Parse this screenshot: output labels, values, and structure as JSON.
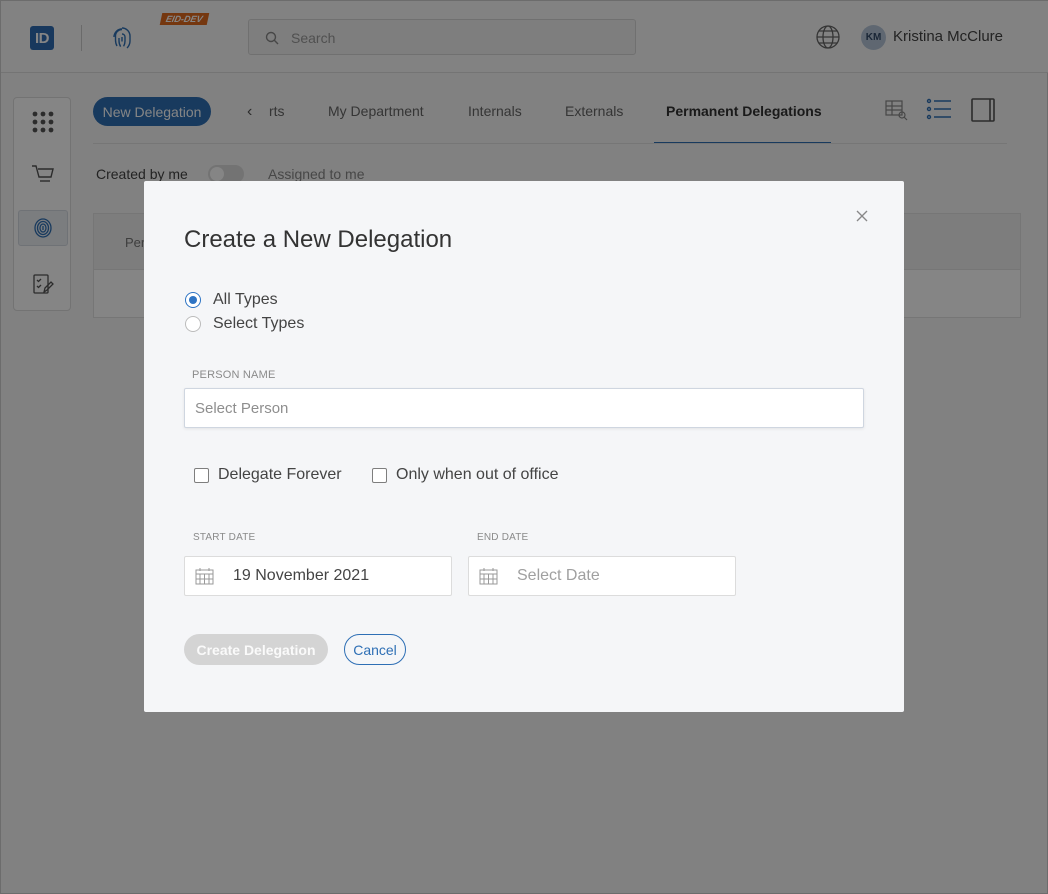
{
  "header": {
    "logo_text": "ID",
    "env_badge": "EID-DEV",
    "search_placeholder": "Search",
    "user_initials": "KM",
    "user_name": "Kristina McClure"
  },
  "toolbar": {
    "new_delegation_label": "New Delegation",
    "tabs": [
      {
        "label": "rts"
      },
      {
        "label": "My Department"
      },
      {
        "label": "Internals"
      },
      {
        "label": "Externals"
      },
      {
        "label": "Permanent Delegations",
        "active": true
      }
    ]
  },
  "filters": {
    "created_by_me": "Created by me",
    "assigned_to_me": "Assigned to me"
  },
  "table": {
    "first_column_partial": "Per"
  },
  "modal": {
    "title": "Create a New Delegation",
    "types": [
      {
        "label": "All Types",
        "checked": true
      },
      {
        "label": "Select Types",
        "checked": false
      }
    ],
    "person_label": "PERSON NAME",
    "person_placeholder": "Select Person",
    "delegate_forever": "Delegate Forever",
    "out_of_office": "Only when out of office",
    "start_date_label": "START DATE",
    "start_date_value": "19 November 2021",
    "end_date_label": "END DATE",
    "end_date_placeholder": "Select Date",
    "create_label": "Create Delegation",
    "cancel_label": "Cancel"
  },
  "colors": {
    "primary": "#2e6fb5",
    "env_badge": "#e06a1e",
    "disabled_button": "#d4d4d4"
  }
}
